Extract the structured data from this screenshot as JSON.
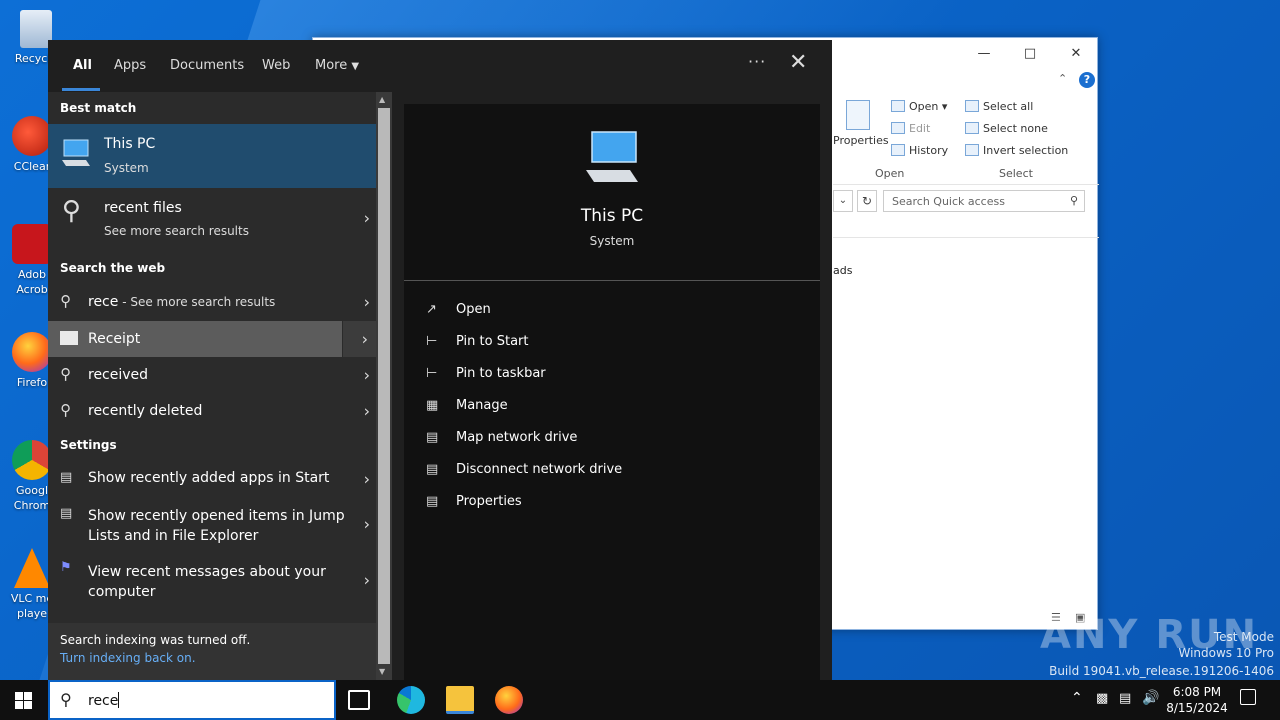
{
  "desktop": {
    "icons": [
      {
        "label": "Recycle"
      },
      {
        "label": "CClear"
      },
      {
        "label": "Adob Acrob"
      },
      {
        "label": "Firefo"
      },
      {
        "label": "Googl Chrom"
      },
      {
        "label": "VLC me playe"
      }
    ],
    "watermark": {
      "logo": "ANY RUN",
      "line1": "Test Mode",
      "line2": "Windows 10 Pro",
      "line3": "Build 19041.vb_release.191206-1406"
    }
  },
  "explorer": {
    "ribbon": {
      "properties": "Properties",
      "open": "Open",
      "edit": "Edit",
      "history": "History",
      "select_all": "Select all",
      "select_none": "Select none",
      "invert_selection": "Invert selection",
      "group_open": "Open",
      "group_select": "Select"
    },
    "search_placeholder": "Search Quick access",
    "fragment": "ads"
  },
  "search": {
    "tabs": {
      "all": "All",
      "apps": "Apps",
      "documents": "Documents",
      "web": "Web",
      "more": "More"
    },
    "sections": {
      "best_match": "Best match",
      "search_web": "Search the web",
      "settings": "Settings"
    },
    "best": {
      "title": "This PC",
      "sub": "System"
    },
    "recent_files": {
      "title": "recent files",
      "sub": "See more search results"
    },
    "web": [
      {
        "text": "rece",
        "suffix": " - See more search results"
      },
      {
        "text": "Receipt"
      },
      {
        "text": "received"
      },
      {
        "text": "recently deleted"
      }
    ],
    "settings": [
      {
        "text": "Show recently added apps in Start"
      },
      {
        "text": "Show recently opened items in Jump Lists and in File Explorer"
      },
      {
        "text": "View recent messages about your computer"
      }
    ],
    "footer": {
      "line": "Search indexing was turned off.",
      "link": "Turn indexing back on."
    },
    "preview": {
      "title": "This PC",
      "sub": "System",
      "actions": [
        "Open",
        "Pin to Start",
        "Pin to taskbar",
        "Manage",
        "Map network drive",
        "Disconnect network drive",
        "Properties"
      ]
    }
  },
  "taskbar": {
    "query": "rece",
    "time": "6:08 PM",
    "date": "8/15/2024"
  }
}
